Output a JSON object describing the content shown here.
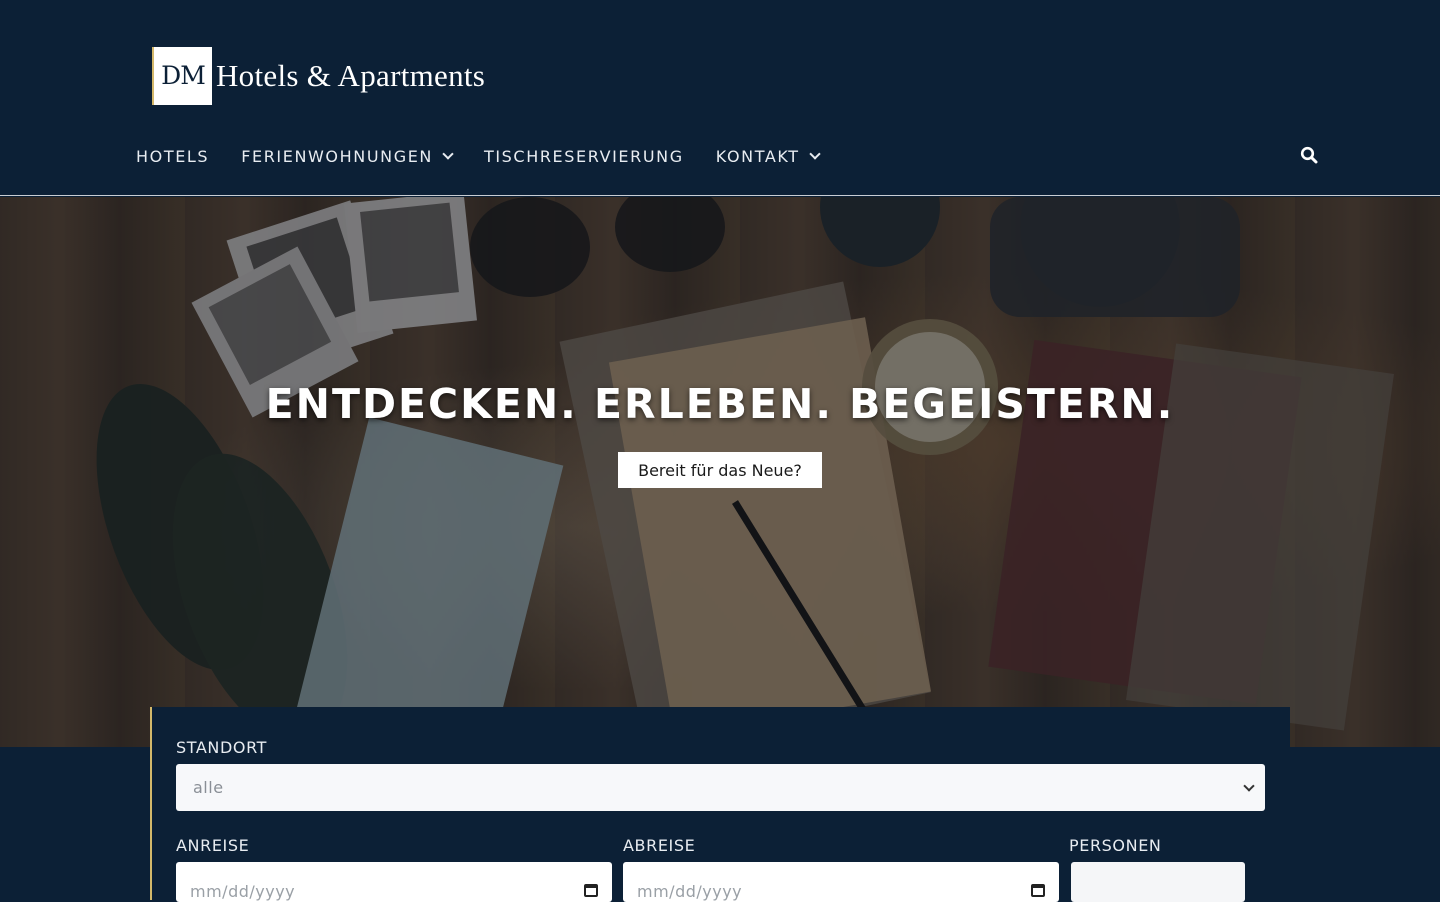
{
  "brand": {
    "logo_mark": "DM",
    "logo_text": "Hotels & Apartments"
  },
  "nav": {
    "items": [
      {
        "label": "HOTELS",
        "has_dropdown": false
      },
      {
        "label": "FERIENWOHNUNGEN",
        "has_dropdown": true
      },
      {
        "label": "TISCHRESERVIERUNG",
        "has_dropdown": false
      },
      {
        "label": "KONTAKT",
        "has_dropdown": true
      }
    ],
    "search_icon": "search-icon"
  },
  "hero": {
    "title": "ENTDECKEN. ERLEBEN. BEGEISTERN.",
    "button_label": "Bereit für das Neue?"
  },
  "booking": {
    "location_label": "STANDORT",
    "location_value": "alle",
    "arrival_label": "ANREISE",
    "arrival_placeholder": "mm/dd/yyyy",
    "departure_label": "ABREISE",
    "departure_placeholder": "mm/dd/yyyy",
    "persons_label": "PERSONEN"
  },
  "colors": {
    "navy": "#0c2036",
    "gold": "#d4b86a",
    "white": "#ffffff"
  }
}
